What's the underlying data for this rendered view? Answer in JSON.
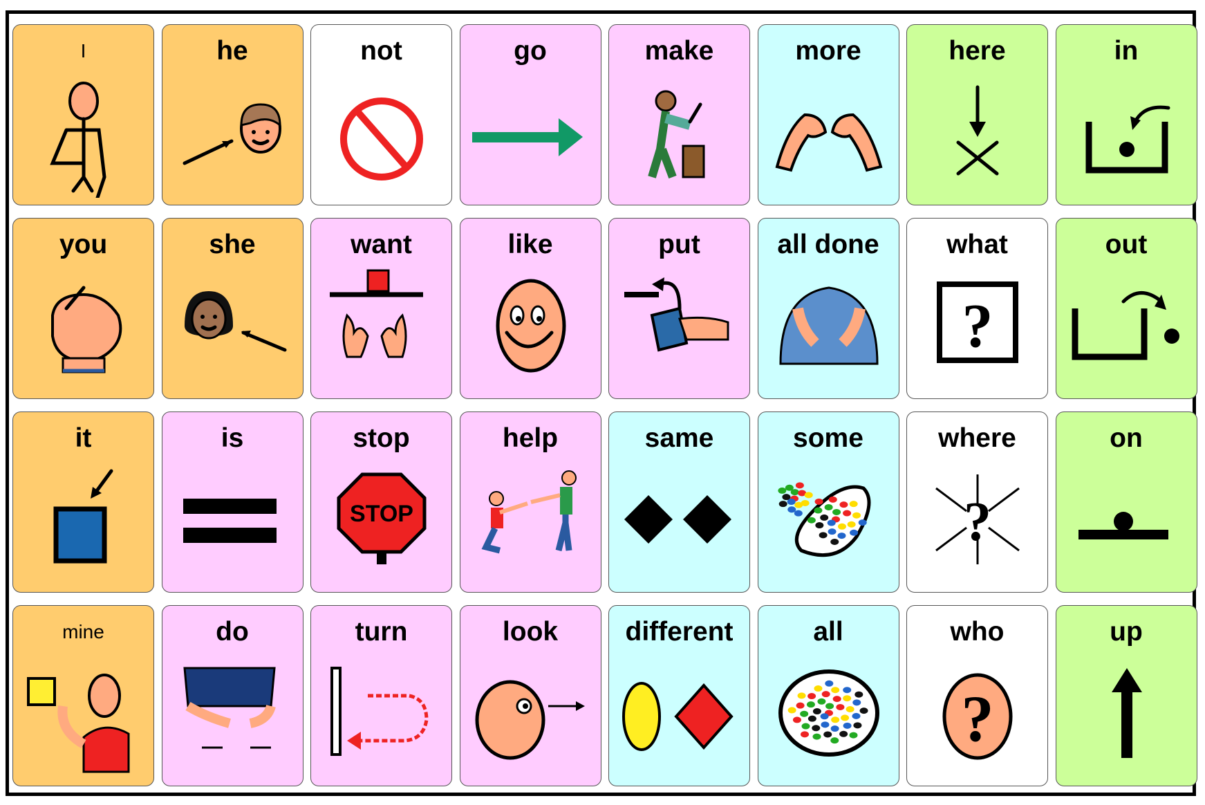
{
  "colors": {
    "pronoun": "#FFCC6E",
    "verb": "#FFCCFF",
    "descriptor": "#CCFFFF",
    "preposition": "#CCFF99",
    "question": "#FFFFFF"
  },
  "rows": [
    [
      {
        "label": "I",
        "type": "pronoun",
        "icon": "self-figure-icon",
        "light": true
      },
      {
        "label": "he",
        "type": "pronoun",
        "icon": "boy-face-icon"
      },
      {
        "label": "not",
        "type": "question",
        "icon": "prohibited-icon"
      },
      {
        "label": "go",
        "type": "verb",
        "icon": "arrow-right-icon"
      },
      {
        "label": "make",
        "type": "verb",
        "icon": "hammer-worker-icon"
      },
      {
        "label": "more",
        "type": "descriptor",
        "icon": "hands-more-icon"
      },
      {
        "label": "here",
        "type": "preposition",
        "icon": "down-arrow-x-icon"
      },
      {
        "label": "in",
        "type": "preposition",
        "icon": "ball-in-box-icon"
      }
    ],
    [
      {
        "label": "you",
        "type": "pronoun",
        "icon": "pointing-hand-icon"
      },
      {
        "label": "she",
        "type": "pronoun",
        "icon": "girl-face-icon"
      },
      {
        "label": "want",
        "type": "verb",
        "icon": "want-hands-icon"
      },
      {
        "label": "like",
        "type": "verb",
        "icon": "smiley-face-icon"
      },
      {
        "label": "put",
        "type": "verb",
        "icon": "put-box-icon"
      },
      {
        "label": "all done",
        "type": "descriptor",
        "icon": "all-done-sign-icon"
      },
      {
        "label": "what",
        "type": "question",
        "icon": "question-box-icon"
      },
      {
        "label": "out",
        "type": "preposition",
        "icon": "ball-out-box-icon"
      }
    ],
    [
      {
        "label": "it",
        "type": "pronoun",
        "icon": "blue-square-icon"
      },
      {
        "label": "is",
        "type": "verb",
        "icon": "equals-icon"
      },
      {
        "label": "stop",
        "type": "verb",
        "icon": "stop-sign-icon",
        "sign_text": "STOP"
      },
      {
        "label": "help",
        "type": "verb",
        "icon": "helping-people-icon"
      },
      {
        "label": "same",
        "type": "descriptor",
        "icon": "two-diamonds-icon"
      },
      {
        "label": "some",
        "type": "descriptor",
        "icon": "some-dots-icon"
      },
      {
        "label": "where",
        "type": "question",
        "icon": "question-arrows-icon"
      },
      {
        "label": "on",
        "type": "preposition",
        "icon": "ball-on-line-icon"
      }
    ],
    [
      {
        "label": "mine",
        "type": "pronoun",
        "icon": "mine-person-icon",
        "light": true
      },
      {
        "label": "do",
        "type": "verb",
        "icon": "do-sign-icon"
      },
      {
        "label": "turn",
        "type": "verb",
        "icon": "turn-arrow-icon"
      },
      {
        "label": "look",
        "type": "verb",
        "icon": "look-face-icon"
      },
      {
        "label": "different",
        "type": "descriptor",
        "icon": "oval-diamond-icon"
      },
      {
        "label": "all",
        "type": "descriptor",
        "icon": "all-dots-icon"
      },
      {
        "label": "who",
        "type": "question",
        "icon": "head-question-icon"
      },
      {
        "label": "up",
        "type": "preposition",
        "icon": "arrow-up-icon"
      }
    ]
  ]
}
